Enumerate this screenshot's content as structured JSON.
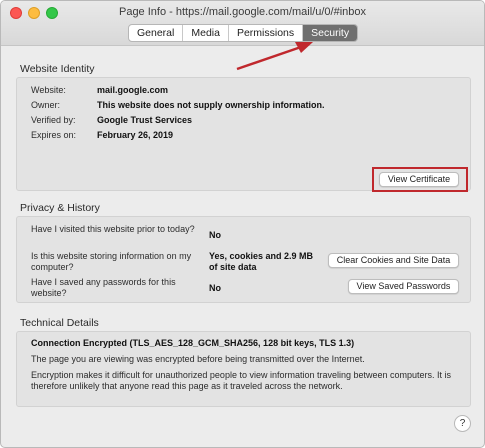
{
  "window": {
    "title": "Page Info - https://mail.google.com/mail/u/0/#inbox"
  },
  "tabs": [
    "General",
    "Media",
    "Permissions",
    "Security"
  ],
  "active_tab": "Security",
  "identity": {
    "section_title": "Website Identity",
    "rows": [
      {
        "label": "Website:",
        "value": "mail.google.com"
      },
      {
        "label": "Owner:",
        "value": "This website does not supply ownership information."
      },
      {
        "label": "Verified by:",
        "value": "Google Trust Services"
      },
      {
        "label": "Expires on:",
        "value": "February 26, 2019"
      }
    ],
    "view_certificate": "View Certificate"
  },
  "privacy": {
    "section_title": "Privacy & History",
    "rows": [
      {
        "question": "Have I visited this website prior to today?",
        "answer": "No",
        "button": ""
      },
      {
        "question": "Is this website storing information on my computer?",
        "answer": "Yes, cookies and 2.9 MB of site data",
        "button": "Clear Cookies and Site Data"
      },
      {
        "question": "Have I saved any passwords for this website?",
        "answer": "No",
        "button": "View Saved Passwords"
      }
    ]
  },
  "technical": {
    "section_title": "Technical Details",
    "heading": "Connection Encrypted (TLS_AES_128_GCM_SHA256, 128 bit keys, TLS 1.3)",
    "line1": "The page you are viewing was encrypted before being transmitted over the Internet.",
    "line2": "Encryption makes it difficult for unauthorized people to view information traveling between computers. It is therefore unlikely that anyone read this page as it traveled across the network."
  },
  "help": "?",
  "colors": {
    "annotation": "#c0282d",
    "active_tab": "#6f6f6f"
  },
  "icons": {
    "help": "question-mark-icon",
    "arrow": "annotation-arrow"
  }
}
